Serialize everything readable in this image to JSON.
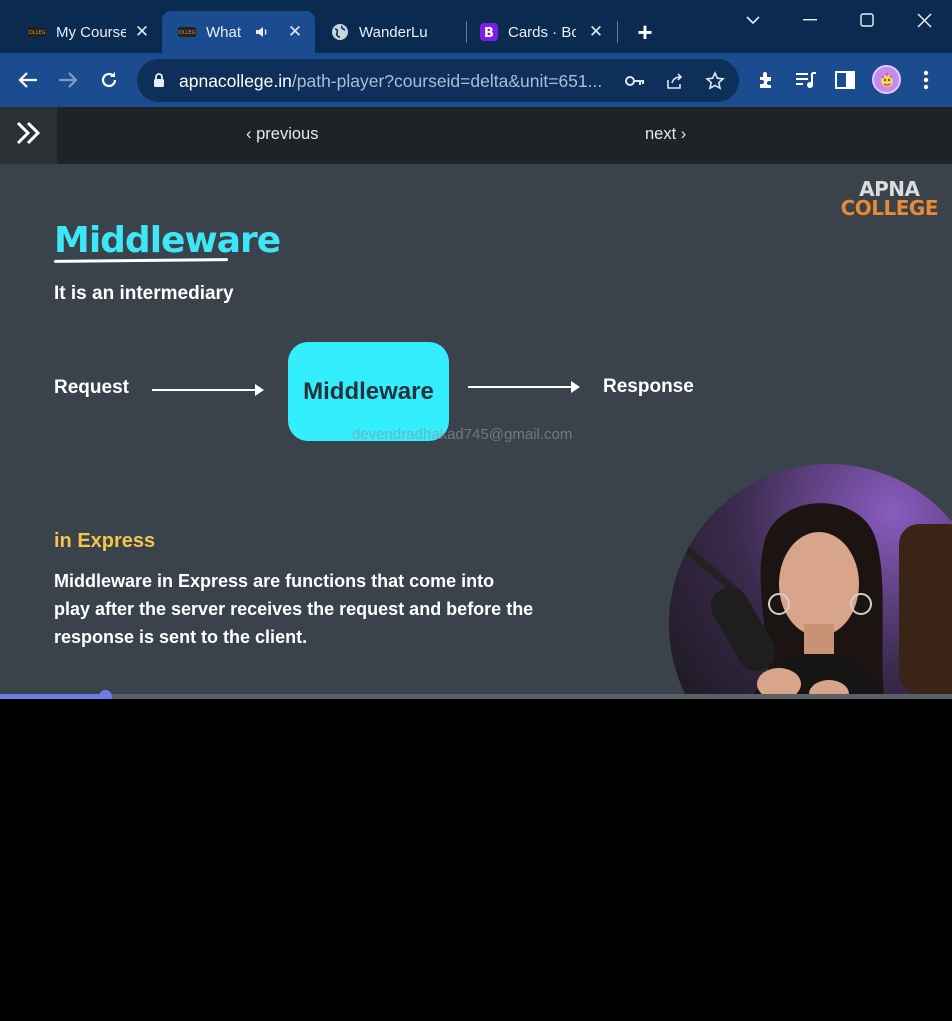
{
  "browser": {
    "tabs": [
      {
        "title": "My Course",
        "favicon": "apna-college-icon",
        "active": false
      },
      {
        "title": "What",
        "favicon": "apna-college-icon",
        "active": true,
        "audio": true
      },
      {
        "title": "WanderLu",
        "favicon": "globe-icon",
        "active": false
      },
      {
        "title": "Cards · Bo",
        "favicon": "bootstrap-icon",
        "active": false
      }
    ],
    "url_host": "apnacollege.in",
    "url_path": "/path-player?courseid=delta&unit=651...",
    "colors": {
      "tabstrip": "#0b2a4f",
      "toolbar": "#1a4c8f",
      "omnibox": "#0d2f5a"
    }
  },
  "player_nav": {
    "previous_label": "previous",
    "next_label": "next"
  },
  "slide": {
    "brand_line1": "APNA",
    "brand_line2": "COLLEGE",
    "title": "Middleware",
    "subtitle": "It is an intermediary",
    "diagram": {
      "left_label": "Request",
      "box_label": "Middleware",
      "right_label": "Response"
    },
    "watermark": "devendradhakad745@gmail.com",
    "section_title": "in Express",
    "description": "Middleware in Express are functions that come into play after the server receives the request and before the response is sent to the client.",
    "colors": {
      "background": "#3a424b",
      "title": "#3ee7f5",
      "box": "#33eefc",
      "section": "#f2c64a"
    }
  },
  "video": {
    "progress": 0.11,
    "progress_color": "#6e7ce8"
  }
}
